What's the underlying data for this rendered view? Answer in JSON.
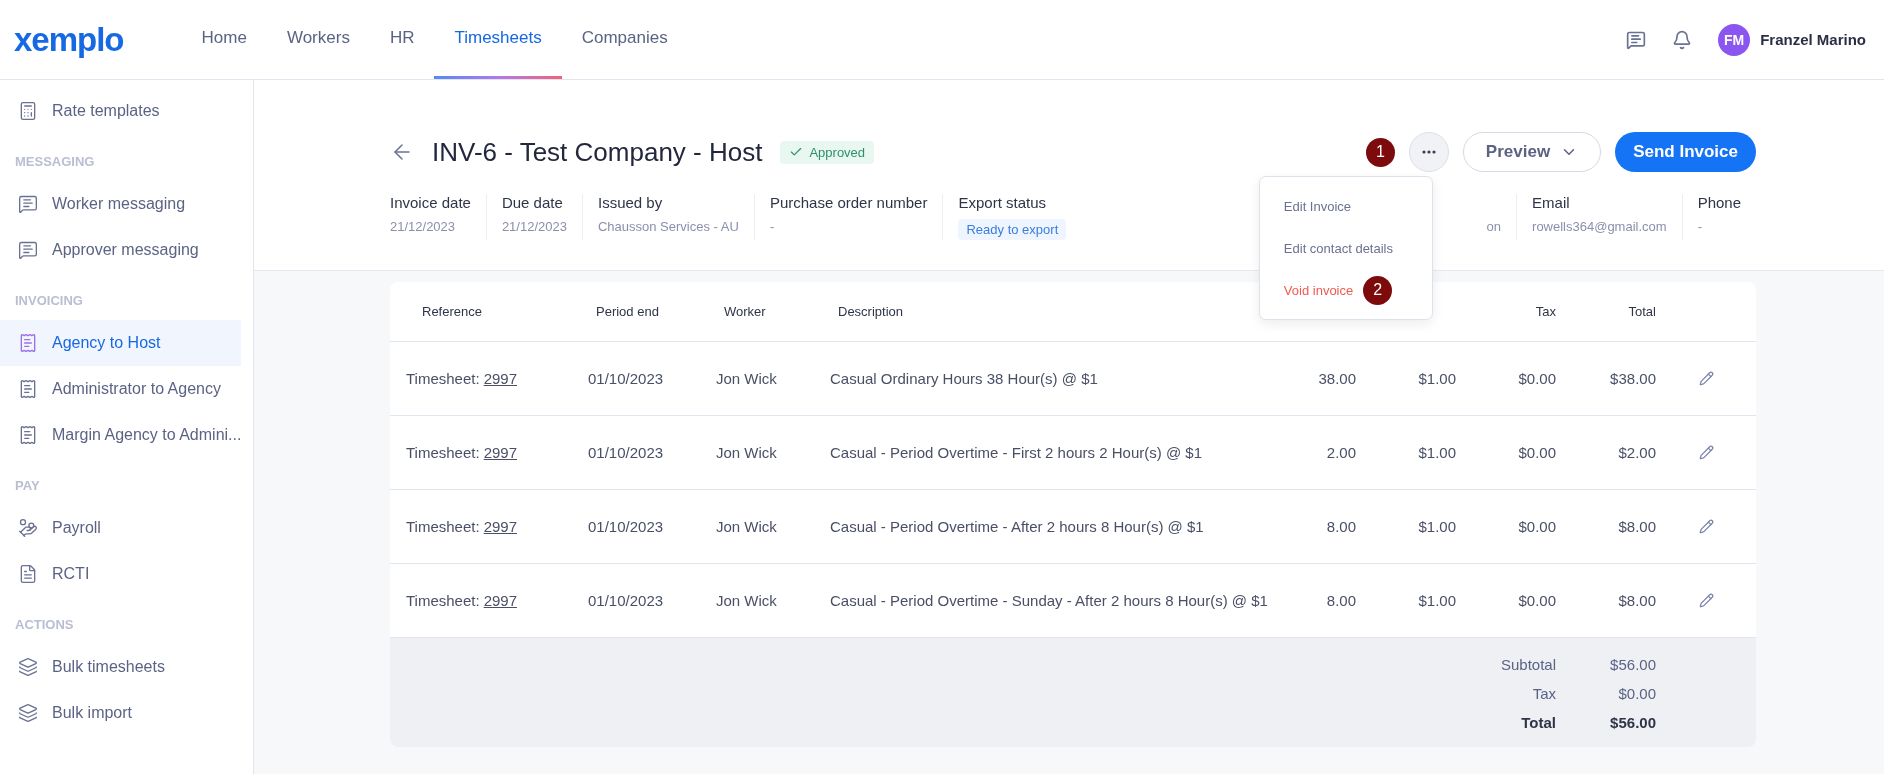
{
  "topbar": {
    "logo": "xemplo",
    "nav": [
      {
        "label": "Home",
        "selected": false
      },
      {
        "label": "Workers",
        "selected": false
      },
      {
        "label": "HR",
        "selected": false
      },
      {
        "label": "Timesheets",
        "selected": true
      },
      {
        "label": "Companies",
        "selected": false
      }
    ],
    "user": {
      "initials": "FM",
      "name": "Franzel Marino"
    }
  },
  "sidebar": {
    "sections": [
      {
        "items": [
          {
            "label": "Rate templates",
            "kind": "calculator",
            "selected": false
          }
        ]
      },
      {
        "heading": "MESSAGING",
        "items": [
          {
            "label": "Worker messaging",
            "kind": "message",
            "selected": false
          },
          {
            "label": "Approver messaging",
            "kind": "message",
            "selected": false
          }
        ]
      },
      {
        "heading": "INVOICING",
        "items": [
          {
            "label": "Agency to Host",
            "kind": "receipt",
            "selected": true
          },
          {
            "label": "Administrator to Agency",
            "kind": "receipt",
            "selected": false
          },
          {
            "label": "Margin Agency to Admini...",
            "kind": "receipt",
            "selected": false
          }
        ]
      },
      {
        "heading": "PAY",
        "items": [
          {
            "label": "Payroll",
            "kind": "payroll",
            "selected": false
          },
          {
            "label": "RCTI",
            "kind": "document",
            "selected": false
          }
        ]
      },
      {
        "heading": "ACTIONS",
        "items": [
          {
            "label": "Bulk timesheets",
            "kind": "layers",
            "selected": false
          },
          {
            "label": "Bulk import",
            "kind": "layers",
            "selected": false
          }
        ]
      }
    ]
  },
  "invoice": {
    "title": "INV-6 - Test Company - Host",
    "status": "Approved",
    "actions": {
      "more_marker": "1",
      "preview": "Preview",
      "send": "Send Invoice"
    },
    "menu": [
      {
        "label": "Edit Invoice",
        "kind": "normal"
      },
      {
        "label": "Edit contact details",
        "kind": "normal"
      },
      {
        "label": "Void invoice",
        "kind": "danger",
        "marker": "2"
      }
    ],
    "meta": [
      {
        "label": "Invoice date",
        "value": "21/12/2023"
      },
      {
        "label": "Due date",
        "value": "21/12/2023"
      },
      {
        "label": "Issued by",
        "value": "Chausson Services - AU"
      },
      {
        "label": "Purchase order number",
        "value": "-"
      },
      {
        "label": "Export status",
        "value": "Ready to export",
        "kind": "tag"
      }
    ],
    "meta_right": [
      {
        "value": "on"
      },
      {
        "label": "Email",
        "value": "rowells364@gmail.com"
      },
      {
        "label": "Phone",
        "value": "-"
      }
    ]
  },
  "table": {
    "columns": [
      "Reference",
      "Period end",
      "Worker",
      "Description",
      "Tax",
      "Total"
    ],
    "rows": [
      {
        "reference_prefix": "Timesheet:",
        "reference_link": "2997",
        "period_end": "01/10/2023",
        "worker": "Jon Wick",
        "description": "Casual Ordinary Hours 38 Hour(s) @ $1",
        "qty": "38.00",
        "rate": "$1.00",
        "tax": "$0.00",
        "total": "$38.00"
      },
      {
        "reference_prefix": "Timesheet:",
        "reference_link": "2997",
        "period_end": "01/10/2023",
        "worker": "Jon Wick",
        "description": "Casual - Period Overtime - First 2 hours 2 Hour(s) @ $1",
        "qty": "2.00",
        "rate": "$1.00",
        "tax": "$0.00",
        "total": "$2.00"
      },
      {
        "reference_prefix": "Timesheet:",
        "reference_link": "2997",
        "period_end": "01/10/2023",
        "worker": "Jon Wick",
        "description": "Casual - Period Overtime - After 2 hours 8 Hour(s) @ $1",
        "qty": "8.00",
        "rate": "$1.00",
        "tax": "$0.00",
        "total": "$8.00"
      },
      {
        "reference_prefix": "Timesheet:",
        "reference_link": "2997",
        "period_end": "01/10/2023",
        "worker": "Jon Wick",
        "description": "Casual - Period Overtime - Sunday - After 2 hours 8 Hour(s) @ $1",
        "qty": "8.00",
        "rate": "$1.00",
        "tax": "$0.00",
        "total": "$8.00"
      }
    ],
    "summary": [
      {
        "label": "Subtotal",
        "value": "$56.00",
        "kind": "normal"
      },
      {
        "label": "Tax",
        "value": "$0.00",
        "kind": "normal"
      },
      {
        "label": "Total",
        "value": "$56.00",
        "kind": "grand"
      }
    ]
  }
}
